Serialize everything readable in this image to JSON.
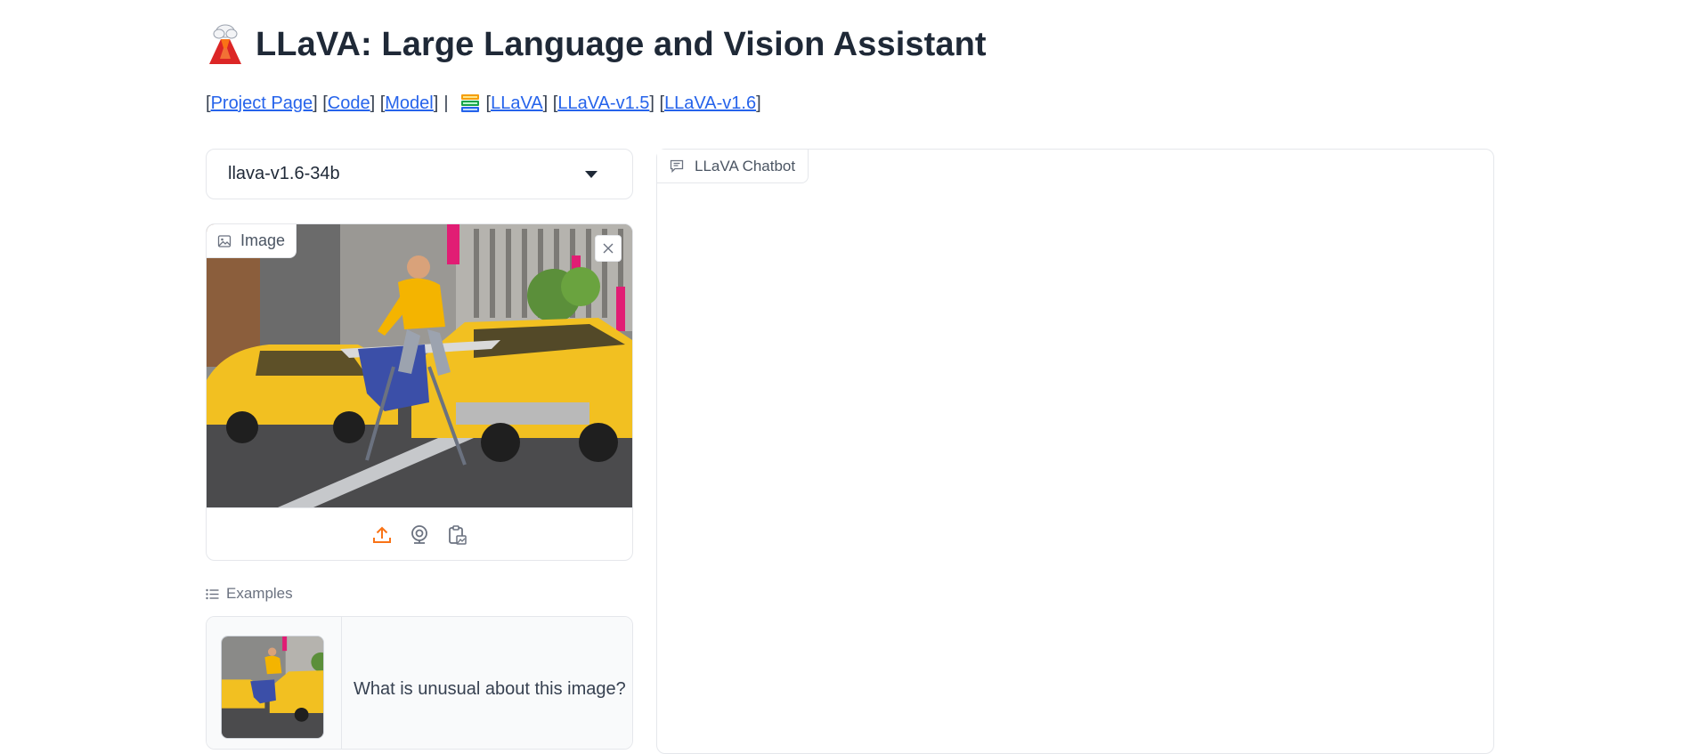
{
  "header": {
    "title": "LLaVA: Large Language and Vision Assistant",
    "logo_icon": "volcano-icon"
  },
  "links": {
    "project_page": "Project Page",
    "code": "Code",
    "model": "Model",
    "separator": "|",
    "books_icon": "books-icon",
    "llava": "LLaVA",
    "llava_v15": "LLaVA-v1.5",
    "llava_v16": "LLaVA-v1.6",
    "link_color": "#2563eb"
  },
  "model_selector": {
    "selected": "llava-v1.6-34b"
  },
  "image_panel": {
    "label": "Image",
    "tools": [
      "upload-icon",
      "webcam-icon",
      "clipboard-icon"
    ],
    "accent": "#f97316"
  },
  "examples": {
    "label": "Examples",
    "rows": [
      {
        "text": "What is unusual about this image?"
      }
    ]
  },
  "chatbot": {
    "label": "LLaVA Chatbot"
  }
}
